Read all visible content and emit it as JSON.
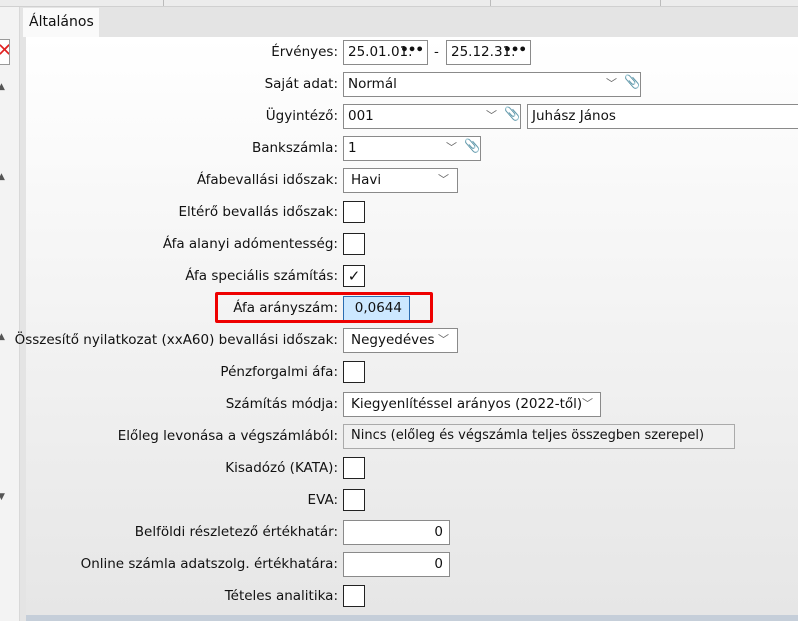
{
  "tab": "Általános",
  "form": {
    "ervenyes": {
      "label": "Érvényes:",
      "from": "25.01.01.",
      "sep": "-",
      "to": "25.12.31."
    },
    "sajat_adat": {
      "label": "Saját adat:",
      "value": "Normál"
    },
    "ugyintezo": {
      "label": "Ügyintéző:",
      "code": "001",
      "name": "Juhász János"
    },
    "bankszamla": {
      "label": "Bankszámla:",
      "value": "1"
    },
    "afabevallasi": {
      "label": "Áfabevallási időszak:",
      "value": "Havi"
    },
    "eltero": {
      "label": "Eltérő bevallás időszak:",
      "checked": false
    },
    "alanyi": {
      "label": "Áfa alanyi adómentesség:",
      "checked": false
    },
    "specialis": {
      "label": "Áfa speciális számítás:",
      "checked": true,
      "mark": "✓"
    },
    "aranyszam": {
      "label": "Áfa arányszám:",
      "value": "0,0644"
    },
    "osszesito": {
      "label": "Összesítő nyilatkozat (xxA60) bevallási időszak:",
      "value": "Negyedéves"
    },
    "penzforgalmi": {
      "label": "Pénzforgalmi áfa:",
      "checked": false
    },
    "szamitas_modja": {
      "label": "Számítás módja:",
      "value": "Kiegyenlítéssel arányos (2022-től)"
    },
    "eloleg": {
      "label": "Előleg levonása a végszámlából:",
      "value": "Nincs (előleg és végszámla teljes összegben szerepel)"
    },
    "kata": {
      "label": "Kisadózó (KATA):",
      "checked": false
    },
    "eva": {
      "label": "EVA:",
      "checked": false
    },
    "belfoldi": {
      "label": "Belföldi részletező értékhatár:",
      "value": "0"
    },
    "online": {
      "label": "Online számla adatszolg. értékhatára:",
      "value": "0"
    },
    "teteles": {
      "label": "Tételes analitika:",
      "checked": false
    }
  },
  "colors": {
    "highlight": "#cce8ff",
    "red": "#ee0000"
  }
}
